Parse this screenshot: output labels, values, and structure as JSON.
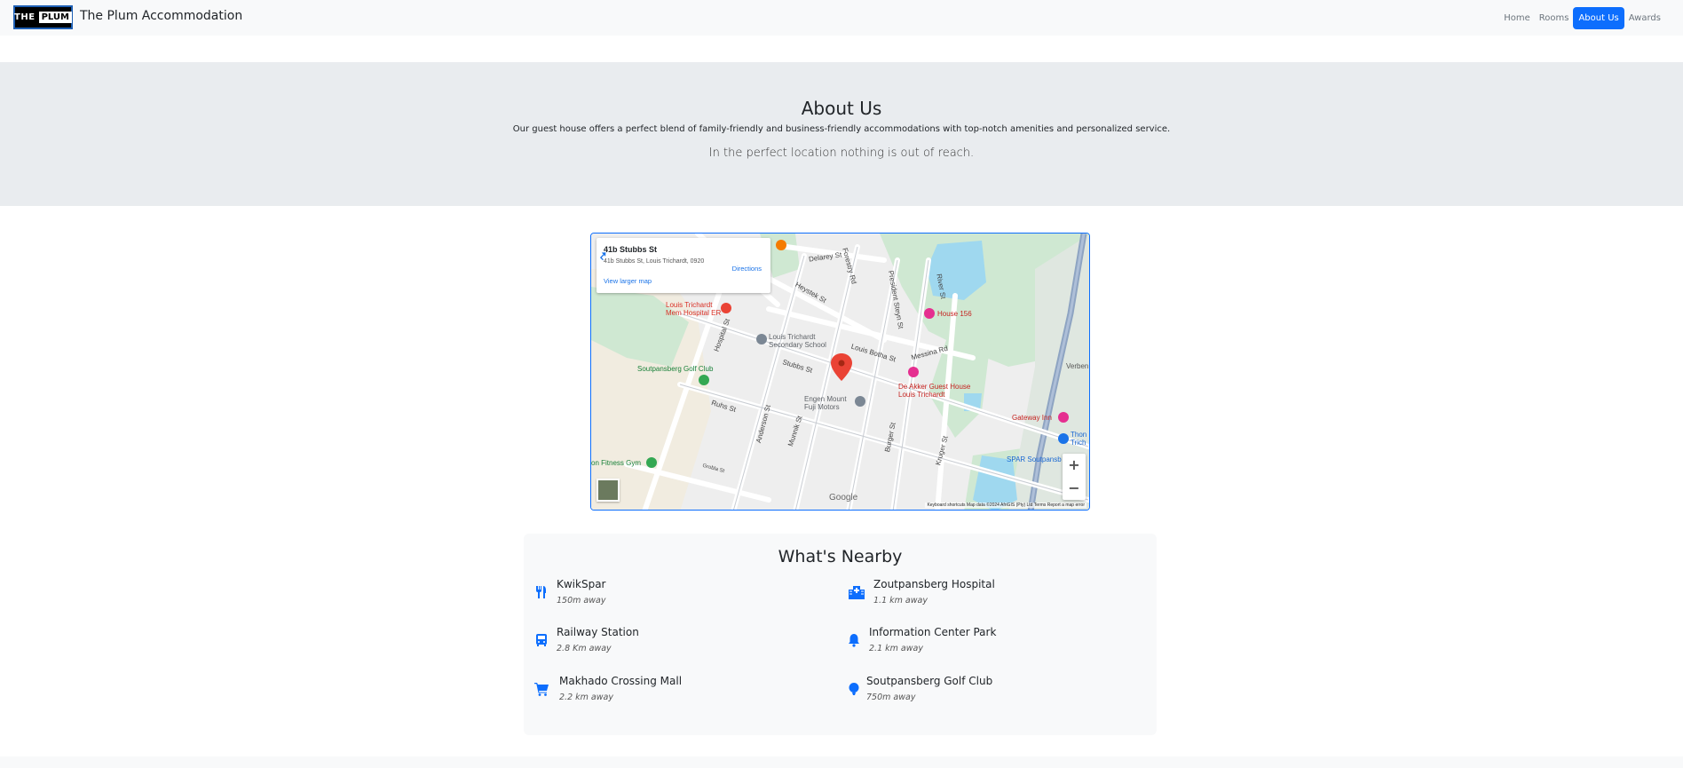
{
  "brand": {
    "logo_left": "THE",
    "logo_right": "PLUM",
    "name": "The Plum Accommodation"
  },
  "nav": [
    {
      "label": "Home",
      "active": false
    },
    {
      "label": "Rooms",
      "active": false
    },
    {
      "label": "About Us",
      "active": true
    },
    {
      "label": "Awards",
      "active": false
    }
  ],
  "hero": {
    "title": "About Us",
    "lead": "Our guest house offers a perfect blend of family-friendly and business-friendly accommodations with top-notch amenities and personalized service.",
    "sublead": "In the perfect location nothing is out of reach."
  },
  "map": {
    "place_title": "41b Stubbs St",
    "place_address": "41b Stubbs St, Louis Trichardt, 0920",
    "directions_label": "Directions",
    "larger_map_label": "View larger map",
    "google_label": "Google",
    "attribution": "Keyboard shortcuts   Map data ©2024 AfriGIS (Pty) Ltd   Terms   Report a map error",
    "zoom_in": "+",
    "zoom_out": "−",
    "labels": {
      "hospital": "Louis Trichardt Mem Hospital ER",
      "school": "Louis Trichardt Secondary School",
      "golf": "Soutpansberg Golf Club",
      "house156": "House 156",
      "deakker": "De Akker Guest House Louis Trichardt",
      "engen": "Engen Mount Fuji Motors",
      "gateway": "Gateway Inn",
      "spar": "SPAR Soutpansb",
      "fitness": "on Fitness Gym",
      "thon": "Thon Trich",
      "verben": "Verben",
      "stubbs": "Stubbs St",
      "ruhs": "Ruhs St",
      "louis_botha": "Louis Botha St",
      "messina": "Messina Rd",
      "delarey": "Delarey St",
      "forestry": "Forestry Rd",
      "heystek": "Heystek St",
      "president_steyn": "President Steyn St",
      "river": "River St",
      "anderson": "Anderson St",
      "munnik": "Munnik St",
      "burger": "Burger St",
      "kruger": "Kruger St",
      "hospital_st": "Hospital St",
      "grobler": "Grobla St"
    }
  },
  "nearby": {
    "title": "What's Nearby",
    "items": [
      {
        "icon": "utensils-icon",
        "name": "KwikSpar",
        "distance": "150m away"
      },
      {
        "icon": "hospital-icon",
        "name": "Zoutpansberg Hospital",
        "distance": "1.1 km away"
      },
      {
        "icon": "bus-icon",
        "name": "Railway Station",
        "distance": "2.8 Km away"
      },
      {
        "icon": "bell-icon",
        "name": "Information Center Park",
        "distance": "2.1 km away"
      },
      {
        "icon": "cart-icon",
        "name": "Makhado Crossing Mall",
        "distance": "2.2 km away"
      },
      {
        "icon": "golf-icon",
        "name": "Soutpansberg Golf Club",
        "distance": "750m away"
      }
    ],
    "icon_color": "#0d6efd"
  }
}
